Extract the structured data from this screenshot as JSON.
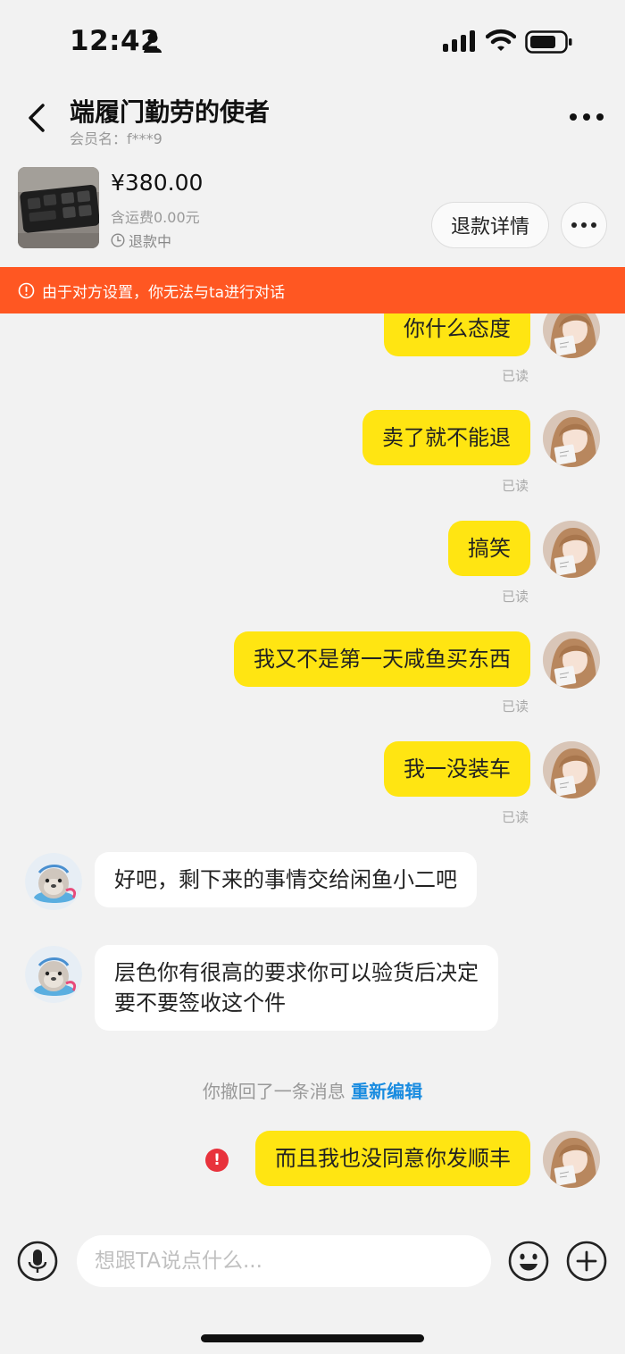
{
  "status_bar": {
    "time": "12:42"
  },
  "header": {
    "title": "端履门勤劳的使者",
    "member_name": "会员名：f***9"
  },
  "product": {
    "price": "¥380.00",
    "shipping": "含运费0.00元",
    "status": "退款中",
    "refund_button": "退款详情"
  },
  "banner": {
    "text": "由于对方设置，你无法与ta进行对话"
  },
  "messages": [
    {
      "sender": "me",
      "text": "你什么态度",
      "read": "已读"
    },
    {
      "sender": "me",
      "text": "卖了就不能退",
      "read": "已读"
    },
    {
      "sender": "me",
      "text": "搞笑",
      "read": "已读"
    },
    {
      "sender": "me",
      "text": "我又不是第一天咸鱼买东西",
      "read": "已读"
    },
    {
      "sender": "me",
      "text": "我一没装车",
      "read": "已读"
    },
    {
      "sender": "other",
      "text": "好吧，剩下来的事情交给闲鱼小二吧"
    },
    {
      "sender": "other",
      "lines": [
        "层色你有很高的要求你可以验货后决定",
        "要不要签收这个件"
      ]
    },
    {
      "sender": "me",
      "text": "而且我也没同意你发顺丰",
      "failed": true
    }
  ],
  "system_note": {
    "text": "你撤回了一条消息",
    "action": "重新编辑"
  },
  "input": {
    "placeholder": "想跟TA说点什么..."
  },
  "colors": {
    "my_bubble": "#ffe512",
    "their_bubble": "#ffffff",
    "banner": "#ff5722",
    "link": "#1a8ce0",
    "error": "#e8323c"
  }
}
